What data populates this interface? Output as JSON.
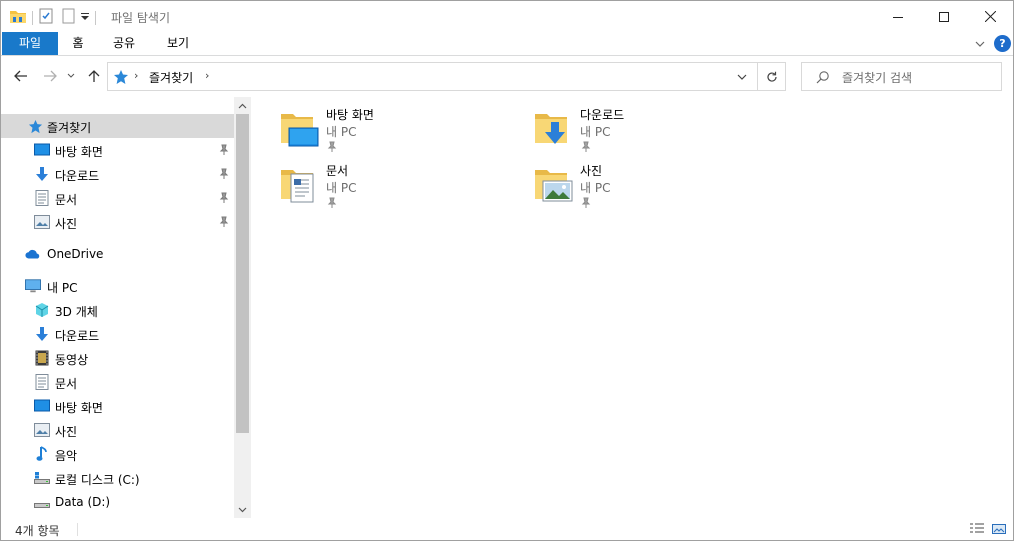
{
  "window": {
    "title": "파일 탐색기"
  },
  "ribbon": {
    "tabs": [
      {
        "label": "파일",
        "active": true
      },
      {
        "label": "홈"
      },
      {
        "label": "공유"
      },
      {
        "label": "보기"
      }
    ],
    "help_label": "?"
  },
  "address": {
    "crumb": "즐겨찾기",
    "separator": "›"
  },
  "search": {
    "placeholder": "즐겨찾기 검색"
  },
  "nav": {
    "quick_access": "즐겨찾기",
    "quick_items": [
      {
        "label": "바탕 화면",
        "icon": "desktop-icon",
        "pinned": true
      },
      {
        "label": "다운로드",
        "icon": "download-icon",
        "pinned": true
      },
      {
        "label": "문서",
        "icon": "document-icon",
        "pinned": true
      },
      {
        "label": "사진",
        "icon": "picture-icon",
        "pinned": true
      }
    ],
    "onedrive": "OneDrive",
    "this_pc": "내 PC",
    "pc_items": [
      {
        "label": "3D 개체",
        "icon": "3d-objects-icon"
      },
      {
        "label": "다운로드",
        "icon": "download-icon"
      },
      {
        "label": "동영상",
        "icon": "video-icon"
      },
      {
        "label": "문서",
        "icon": "document-icon"
      },
      {
        "label": "바탕 화면",
        "icon": "desktop-icon"
      },
      {
        "label": "사진",
        "icon": "picture-icon"
      },
      {
        "label": "음악",
        "icon": "music-icon"
      },
      {
        "label": "로컬 디스크 (C:)",
        "icon": "local-disk-icon"
      },
      {
        "label": "Data (D:)",
        "icon": "drive-icon"
      }
    ]
  },
  "content": {
    "tiles": [
      {
        "name": "바탕 화면",
        "sub": "내 PC",
        "icon": "desktop-folder-icon"
      },
      {
        "name": "다운로드",
        "sub": "내 PC",
        "icon": "download-folder-icon"
      },
      {
        "name": "문서",
        "sub": "내 PC",
        "icon": "document-folder-icon"
      },
      {
        "name": "사진",
        "sub": "내 PC",
        "icon": "picture-folder-icon"
      }
    ]
  },
  "status": {
    "item_count": "4개 항목"
  },
  "colors": {
    "accent": "#1979ca",
    "selection": "#d9d9d9",
    "folder": "#f8d775",
    "muted_text": "#6d6d6d"
  }
}
